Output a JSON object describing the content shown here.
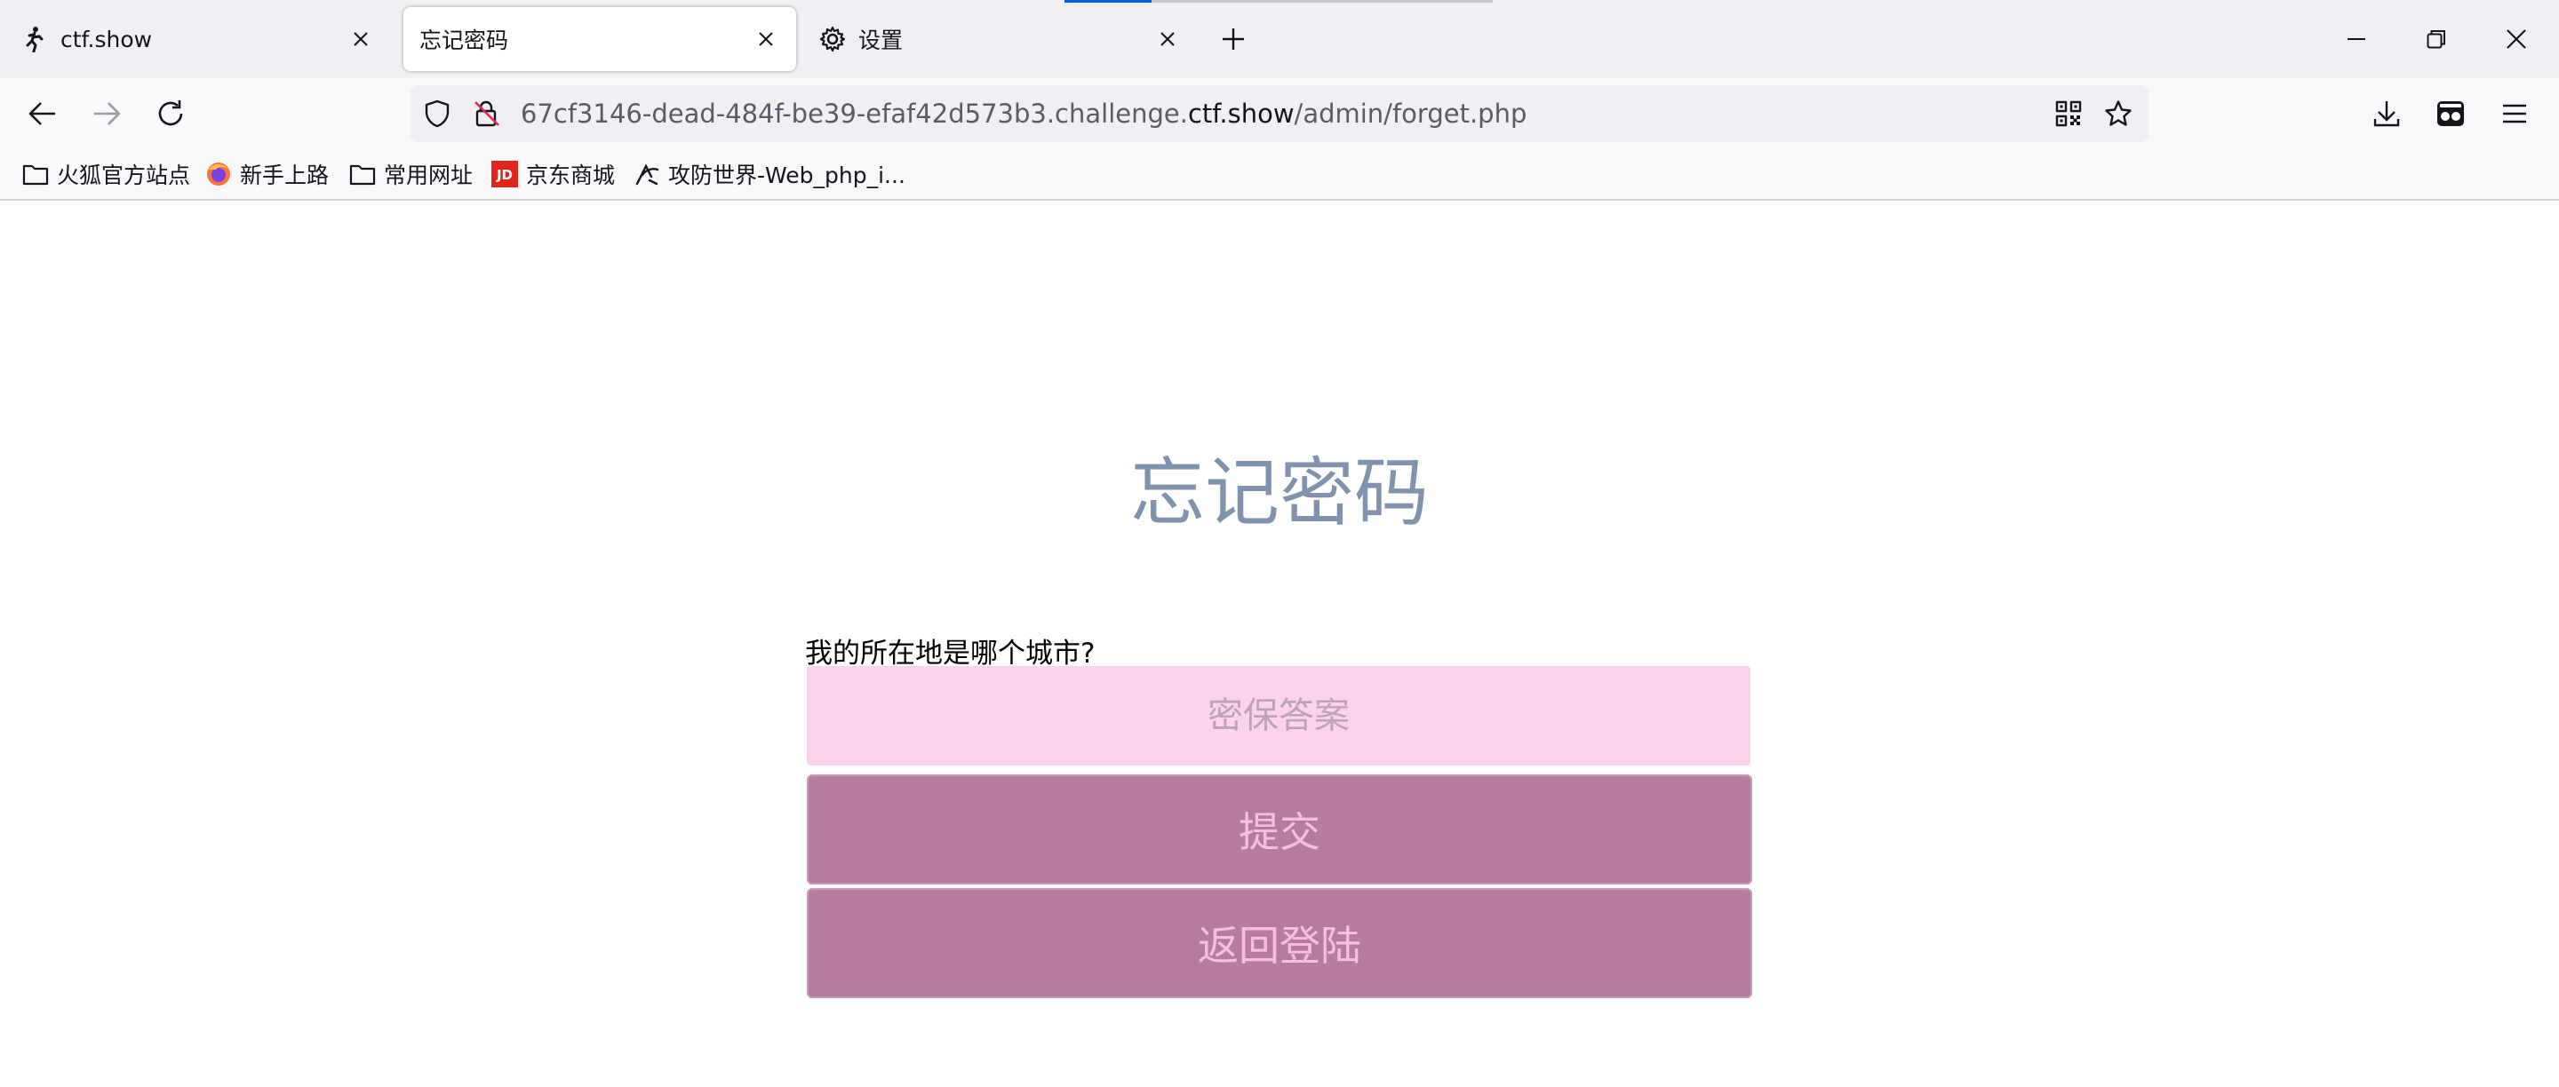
{
  "browser": {
    "tabs": [
      {
        "title": "ctf.show",
        "icon": "ctfshow-runner-icon"
      },
      {
        "title": "忘记密码",
        "icon": "none"
      },
      {
        "title": "设置",
        "icon": "gear-icon"
      }
    ],
    "url": {
      "prefix": "67cf3146-dead-484f-be39-efaf42d573b3.challenge.",
      "domain": "ctf.show",
      "path": "/admin/forget.php"
    },
    "bookmarks": [
      {
        "label": "火狐官方站点",
        "icon": "folder-icon"
      },
      {
        "label": "新手上路",
        "icon": "firefox-icon"
      },
      {
        "label": "常用网址",
        "icon": "folder-icon"
      },
      {
        "label": "京东商城",
        "icon": "jd-icon"
      },
      {
        "label": "攻防世界-Web_php_i...",
        "icon": "adworld-icon"
      }
    ]
  },
  "page": {
    "title": "忘记密码",
    "question": "我的所在地是哪个城市?",
    "answer_placeholder": "密保答案",
    "submit_label": "提交",
    "back_label": "返回登陆"
  },
  "colors": {
    "title": "#8092ad",
    "input_bg": "#fcd3eb",
    "button_bg": "#b57c9f",
    "button_text": "#f6bfe0"
  }
}
